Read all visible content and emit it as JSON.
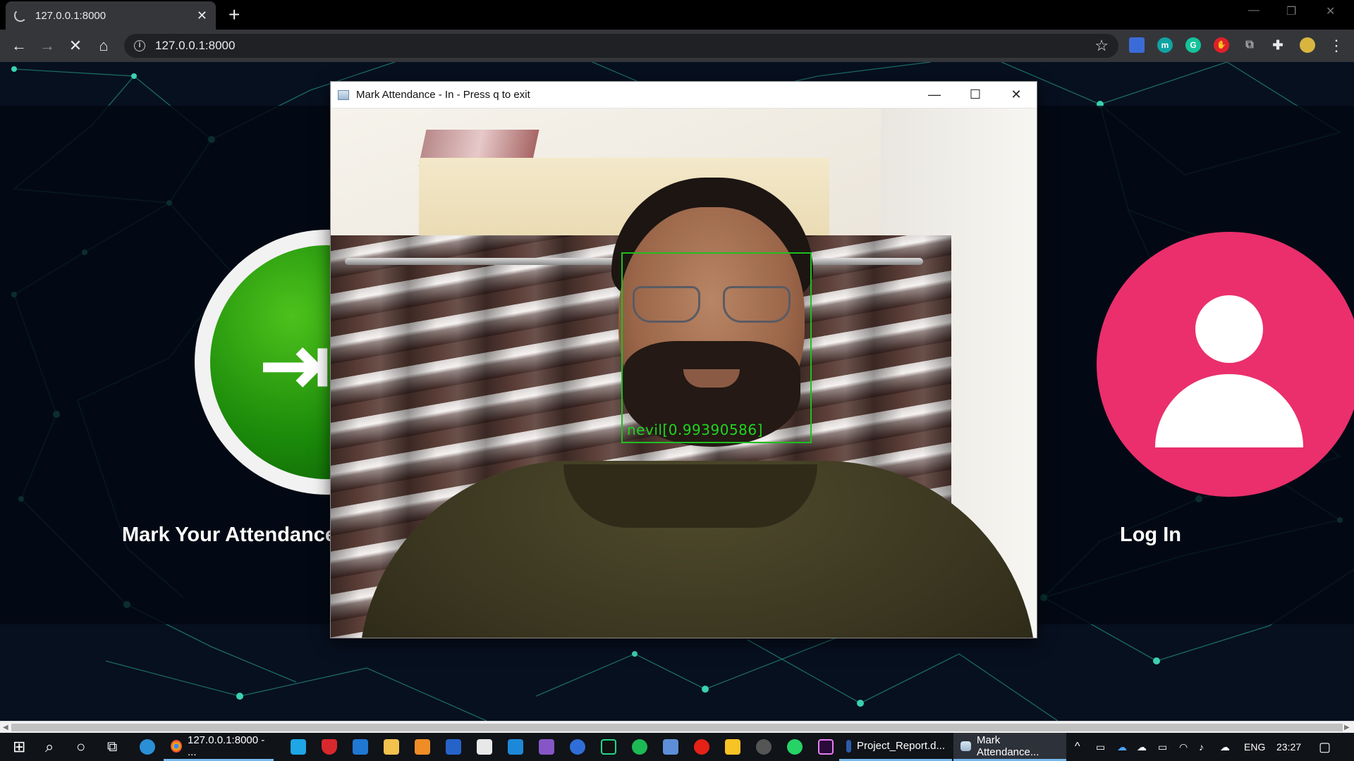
{
  "browser": {
    "tab_title": "127.0.0.1:8000",
    "tab_close": "✕",
    "new_tab": "+",
    "url": "127.0.0.1:8000",
    "nav": {
      "back": "←",
      "forward": "→",
      "stop": "✕",
      "home": "⌂"
    },
    "star": "☆",
    "extensions": [
      {
        "name": "blue-ext-icon",
        "color": "#3b6bd6",
        "glyph": ""
      },
      {
        "name": "m-ext-icon",
        "color": "#10a3a3",
        "glyph": "m"
      },
      {
        "name": "grammarly-icon",
        "color": "#15c39a",
        "glyph": "G"
      },
      {
        "name": "red-hand-ext-icon",
        "color": "#e0202a",
        "glyph": "✋"
      },
      {
        "name": "copy-ext-icon",
        "color": "#555",
        "glyph": "⧉"
      },
      {
        "name": "puzzle-ext-icon",
        "color": "#35363a",
        "glyph": "✚"
      },
      {
        "name": "profile-avatar-icon",
        "color": "#d9b540",
        "glyph": "●"
      }
    ],
    "menu": "⋮",
    "window_controls": {
      "minimize": "—",
      "restore": "❐",
      "close": "✕"
    }
  },
  "page": {
    "mark_label": "Mark Your Attendance",
    "login_label": "Log In",
    "colors": {
      "green": "#1b8a0a",
      "pink": "#ea2f6c",
      "network_line": "#2bb59a"
    }
  },
  "cv_window": {
    "title": "Mark Attendance - In - Press q to exit",
    "minimize": "—",
    "maximize": "☐",
    "close": "✕",
    "detection_label": "nevil[0.99390586]"
  },
  "taskbar": {
    "chrome_label": "127.0.0.1:8000 - ...",
    "word_label": "Project_Report.d...",
    "cv_label": "Mark Attendance...",
    "language": "ENG",
    "time": "23:27"
  }
}
